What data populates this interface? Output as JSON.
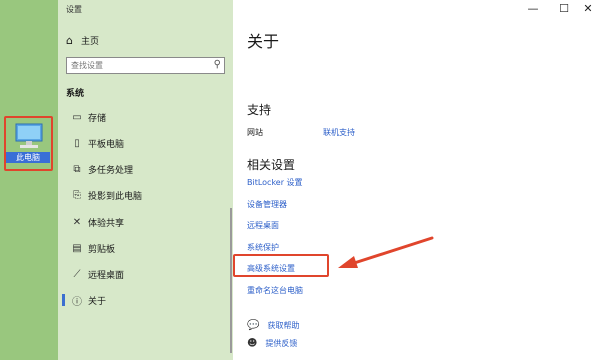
{
  "desktop": {
    "pc_label": "此电脑"
  },
  "window": {
    "title": "设置",
    "controls": {
      "minimize": "—",
      "maximize": "☐",
      "close": "✕"
    }
  },
  "sidebar": {
    "home": "主页",
    "search_placeholder": "查找设置",
    "section": "系统",
    "items": [
      {
        "label": "存储",
        "icon": "storage-icon",
        "glyph": "▭"
      },
      {
        "label": "平板电脑",
        "icon": "tablet-icon",
        "glyph": "▯"
      },
      {
        "label": "多任务处理",
        "icon": "multitasking-icon",
        "glyph": "⧉"
      },
      {
        "label": "投影到此电脑",
        "icon": "projecting-icon",
        "glyph": "⎘"
      },
      {
        "label": "体验共享",
        "icon": "shared-experience-icon",
        "glyph": "✕"
      },
      {
        "label": "剪贴板",
        "icon": "clipboard-icon",
        "glyph": "▤"
      },
      {
        "label": "远程桌面",
        "icon": "remote-desktop-icon",
        "glyph": "⟋"
      },
      {
        "label": "关于",
        "icon": "info-icon",
        "glyph": "ⓘ"
      }
    ]
  },
  "content": {
    "title": "关于",
    "support": {
      "title": "支持",
      "website_label": "网站",
      "online_support": "联机支持"
    },
    "related": {
      "title": "相关设置",
      "links": [
        "BitLocker 设置",
        "设备管理器",
        "远程桌面",
        "系统保护",
        "高级系统设置",
        "重命名这台电脑"
      ]
    },
    "help": {
      "get_help": "获取帮助",
      "feedback": "提供反馈"
    }
  },
  "colors": {
    "accent": "#2c5fc9",
    "sidebar_bg": "#d7e8c9",
    "desktop_bg": "#99c77e",
    "highlight": "#e0452c"
  }
}
